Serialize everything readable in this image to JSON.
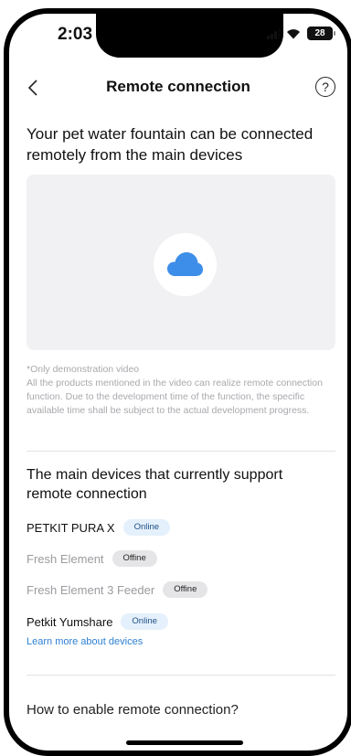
{
  "status": {
    "time": "2:03",
    "battery": "28"
  },
  "nav": {
    "title": "Remote connection",
    "back_icon": "chevron-left-icon",
    "help_icon": "question-circle-icon",
    "help_glyph": "?"
  },
  "intro": {
    "heading": "Your pet water fountain can be connected remotely from the main devices"
  },
  "video": {
    "icon": "cloud-icon",
    "accent": "#3d8ee8"
  },
  "disclaimer": {
    "line1": "*Only demonstration video",
    "line2": "All the products mentioned in the video can realize remote connection function. Due to the development time of the function, the specific available time shall be subject to the actual development progress."
  },
  "devices_section": {
    "title": "The main devices that currently support remote connection",
    "devices": [
      {
        "name": "PETKIT PURA X",
        "status": "Online"
      },
      {
        "name": "Fresh Element",
        "status": "Offine"
      },
      {
        "name": "Fresh Element 3 Feeder",
        "status": "Offine"
      },
      {
        "name": "Petkit Yumshare",
        "status": "Online"
      }
    ],
    "learn_more": "Learn more about devices"
  },
  "how_to": {
    "label": "How to enable remote connection?"
  }
}
